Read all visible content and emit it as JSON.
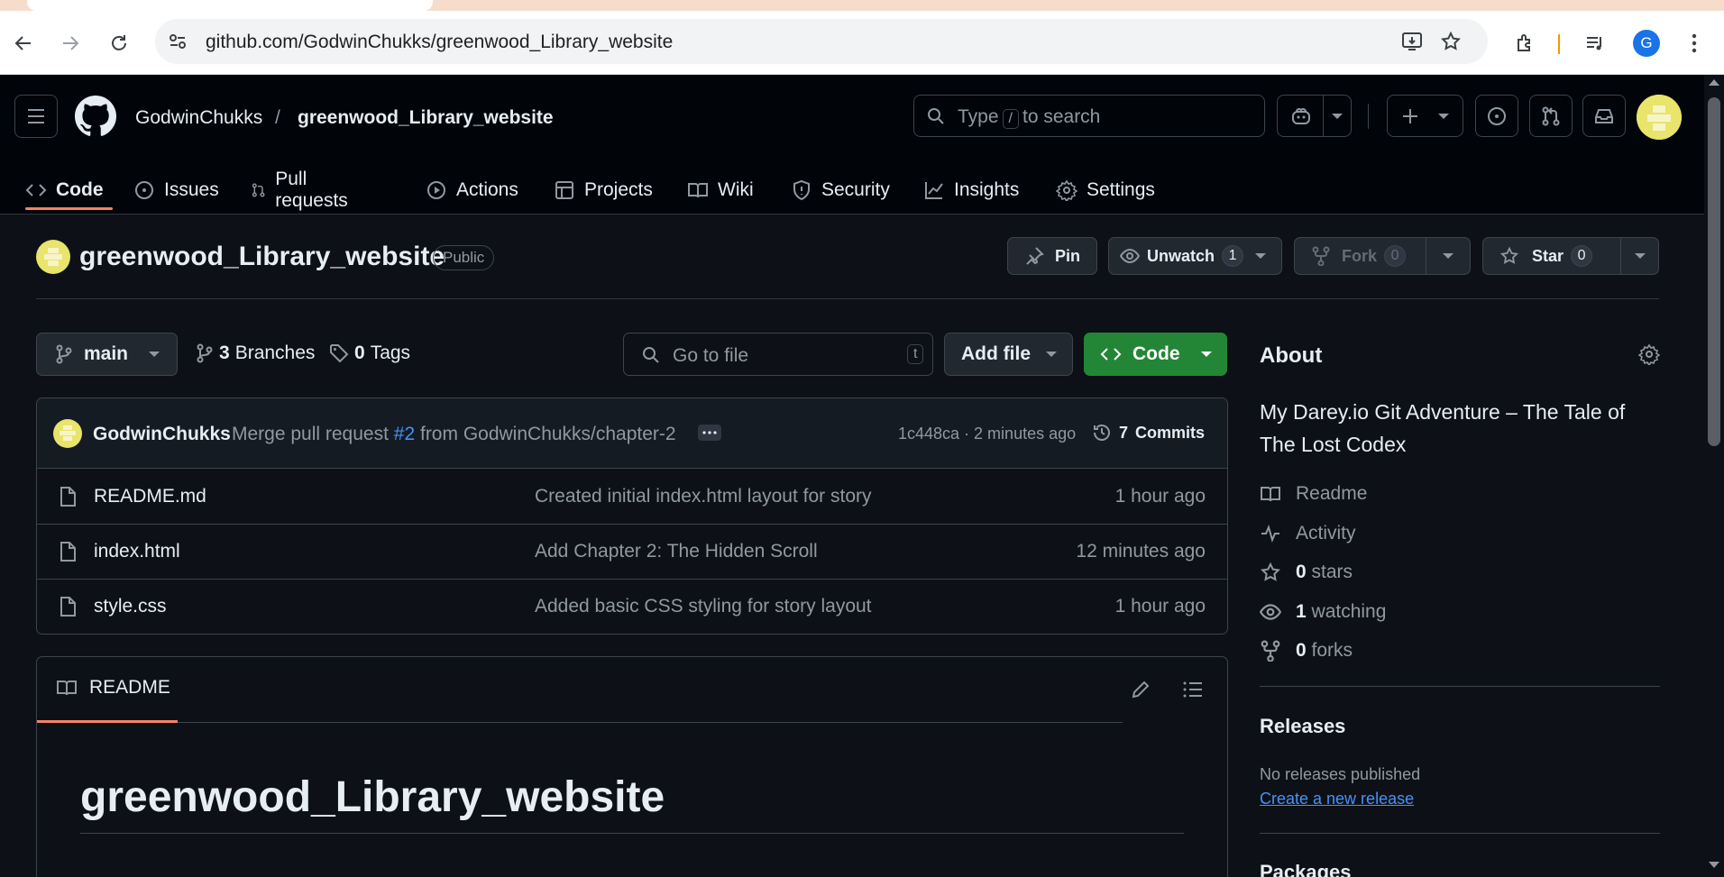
{
  "browser": {
    "url": "github.com/GodwinChukks/greenwood_Library_website",
    "profile_initial": "G"
  },
  "header": {
    "owner": "GodwinChukks",
    "separator": "/",
    "repo": "greenwood_Library_website",
    "search_type": "Type",
    "search_key": "/",
    "search_rest": "to search"
  },
  "nav": {
    "items": [
      {
        "label": "Code",
        "icon": "code-icon"
      },
      {
        "label": "Issues",
        "icon": "issue-icon"
      },
      {
        "label": "Pull requests",
        "icon": "pull-request-icon"
      },
      {
        "label": "Actions",
        "icon": "play-icon"
      },
      {
        "label": "Projects",
        "icon": "table-icon"
      },
      {
        "label": "Wiki",
        "icon": "book-icon"
      },
      {
        "label": "Security",
        "icon": "shield-icon"
      },
      {
        "label": "Insights",
        "icon": "graph-icon"
      },
      {
        "label": "Settings",
        "icon": "gear-icon"
      }
    ]
  },
  "repo": {
    "name": "greenwood_Library_website",
    "visibility": "Public",
    "pin_label": "Pin",
    "unwatch_label": "Unwatch",
    "watch_count": "1",
    "fork_label": "Fork",
    "fork_count": "0",
    "star_label": "Star",
    "star_count": "0"
  },
  "files": {
    "branch": "main",
    "branches_count": "3",
    "branches_label": "Branches",
    "tags_count": "0",
    "tags_label": "Tags",
    "go_to_file": "Go to file",
    "go_to_file_key": "t",
    "add_file": "Add file",
    "code_button": "Code",
    "commit": {
      "author": "GodwinChukks",
      "message_prefix": "Merge pull request",
      "pr_link": "#2",
      "message_suffix": "from GodwinChukks/chapter-2",
      "hash_time": "1c448ca · 2 minutes ago",
      "commits_count": "7",
      "commits_label": "Commits"
    },
    "rows": [
      {
        "name": "README.md",
        "message": "Created initial index.html layout for story",
        "time": "1 hour ago"
      },
      {
        "name": "index.html",
        "message": "Add Chapter 2: The Hidden Scroll",
        "time": "12 minutes ago"
      },
      {
        "name": "style.css",
        "message": "Added basic CSS styling for story layout",
        "time": "1 hour ago"
      }
    ]
  },
  "readme": {
    "tab_label": "README",
    "heading": "greenwood_Library_website"
  },
  "sidebar": {
    "about_title": "About",
    "description": "My Darey.io Git Adventure – The Tale of The Lost Codex",
    "readme_label": "Readme",
    "activity_label": "Activity",
    "stars_count": "0",
    "stars_label": "stars",
    "watching_count": "1",
    "watching_label": "watching",
    "forks_count": "0",
    "forks_label": "forks",
    "releases_title": "Releases",
    "releases_empty": "No releases published",
    "create_release": "Create a new release",
    "packages_title": "Packages"
  },
  "colors": {
    "background": "#0d1117",
    "header_bg": "#010409",
    "accent_underline": "#f78166",
    "code_button": "#238636",
    "link": "#4493f8"
  }
}
